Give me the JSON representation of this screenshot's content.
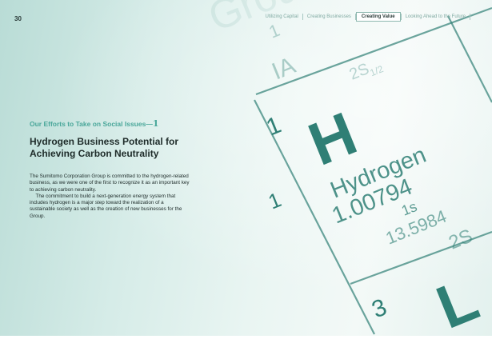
{
  "page_number": "30",
  "nav": {
    "items": [
      {
        "label": "Utilizing Capital"
      },
      {
        "label": "Creating Businesses"
      },
      {
        "label": "Creating Value"
      },
      {
        "label": "Looking Ahead to the Future"
      }
    ],
    "active_index": 2
  },
  "section": {
    "kicker": "Our Efforts to Take on Social Issues—",
    "kicker_number": "1",
    "headline_line1": "Hydrogen Business Potential for",
    "headline_line2": "Achieving Carbon Neutrality"
  },
  "body": {
    "paragraph1": "The Sumitomo Corporation Group is committed to the hydrogen-related business, as we were one of the first to recognize it as an important key to achieving carbon neutrality.",
    "paragraph2": "The commitment to build a next-generation energy system that includes hydrogen is a major step toward the realization of a sustainable society as well as the creation of new businesses for the Group."
  },
  "periodic_table": {
    "group_word": "Grou",
    "group_number": "1",
    "group_roman": "IA",
    "orbital_header": "2S",
    "orbital_header_sub": "1/2",
    "atomic_number": "1",
    "symbol": "H",
    "name": "Hydrogen",
    "atomic_mass": "1.00794",
    "period_number": "1",
    "electron_config": "1s",
    "ionization_energy": "13.5984",
    "next_orbital": "2S",
    "next_atomic_number": "3",
    "next_symbol": "L"
  },
  "colors": {
    "accent": "#4aa79a",
    "heading": "#1e2b29",
    "art_ink": "#3f8a80"
  }
}
